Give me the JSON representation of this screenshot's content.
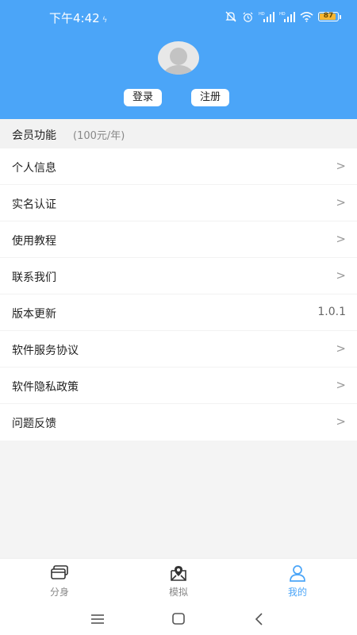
{
  "status_bar": {
    "time": "下午4:42",
    "battery": "87",
    "net_label_1": "HD",
    "net_label_2": "HD"
  },
  "header": {
    "login_label": "登录",
    "register_label": "注册"
  },
  "member": {
    "title": "会员功能",
    "price": "(100元/年)"
  },
  "menu": [
    {
      "label": "个人信息",
      "chevron": ">"
    },
    {
      "label": "实名认证",
      "chevron": ">"
    },
    {
      "label": "使用教程",
      "chevron": ">"
    },
    {
      "label": "联系我们",
      "chevron": ">"
    },
    {
      "label": "版本更新",
      "value": "1.0.1"
    },
    {
      "label": "软件服务协议",
      "chevron": ">"
    },
    {
      "label": "软件隐私政策",
      "chevron": ">"
    },
    {
      "label": "问题反馈",
      "chevron": ">"
    }
  ],
  "tabs": [
    {
      "label": "分身",
      "icon": "clone-icon"
    },
    {
      "label": "模拟",
      "icon": "map-pin-icon"
    },
    {
      "label": "我的",
      "icon": "user-icon",
      "active": true
    }
  ],
  "colors": {
    "accent": "#4ba5f8",
    "battery": "#f7b733"
  }
}
